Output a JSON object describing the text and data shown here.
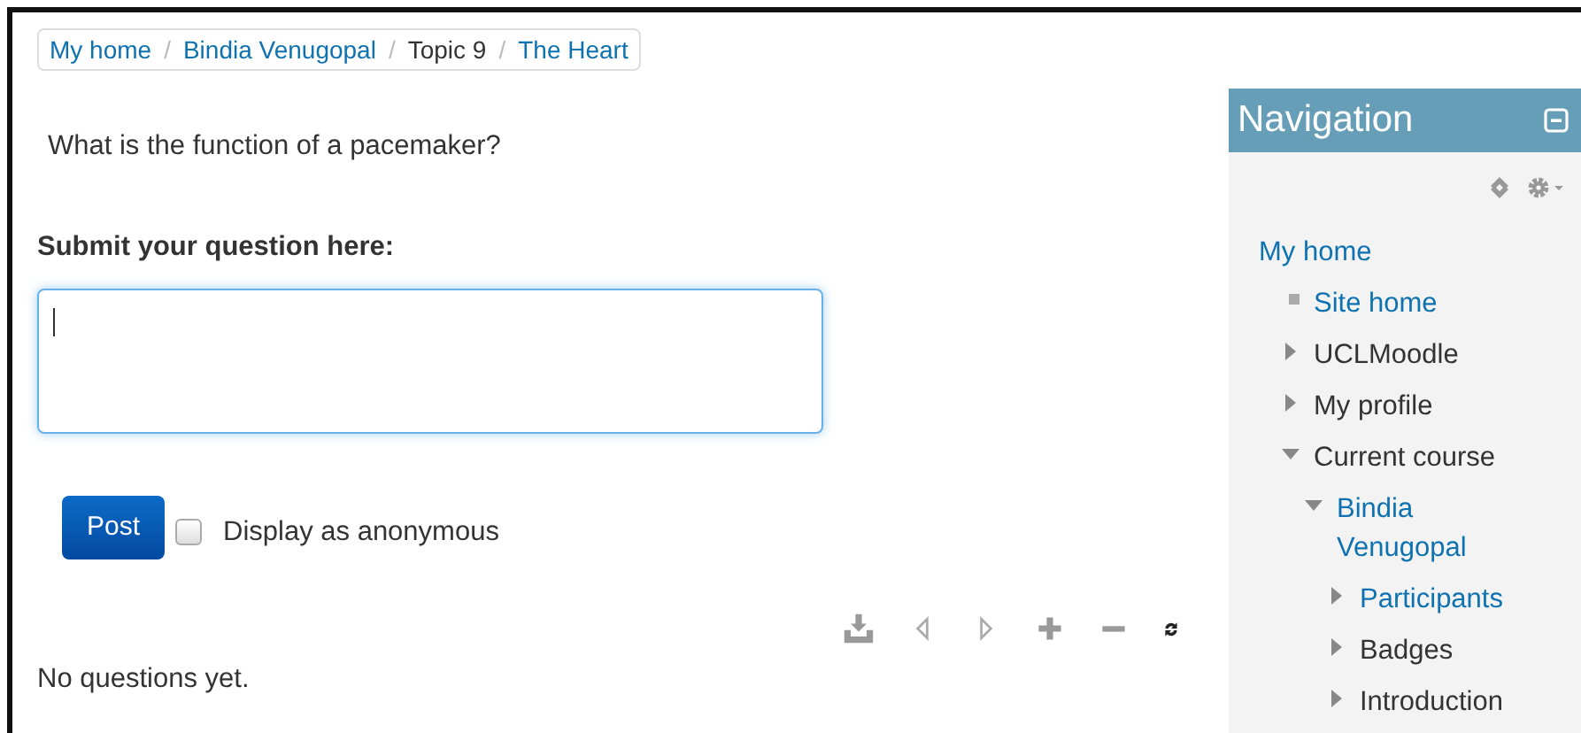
{
  "breadcrumb": [
    {
      "label": "My home",
      "link": true
    },
    {
      "separator": "/",
      "label": "Bindia Venugopal",
      "link": true
    },
    {
      "separator": "/",
      "label": "Topic 9",
      "link": false
    },
    {
      "separator": "/",
      "label": "The Heart",
      "link": true
    }
  ],
  "question": "What is the function of a pacemaker?",
  "form": {
    "label": "Submit your question here:",
    "button": "Post",
    "anonymous": {
      "label": "Display as anonymous",
      "checked": false
    }
  },
  "empty_message": "No questions yet.",
  "navigation": {
    "title": "Navigation",
    "items": [
      {
        "label": "My home",
        "link": true,
        "kind": "root",
        "children": [
          {
            "label": "Site home",
            "link": true,
            "kind": "leaf"
          },
          {
            "label": "UCLMoodle",
            "link": false,
            "kind": "branch",
            "expanded": false
          },
          {
            "label": "My profile",
            "link": false,
            "kind": "branch",
            "expanded": false
          },
          {
            "label": "Current course",
            "link": false,
            "kind": "branch",
            "expanded": true,
            "children": [
              {
                "label": "Bindia Venugopal",
                "link": true,
                "kind": "branch",
                "expanded": true,
                "children": [
                  {
                    "label": "Participants",
                    "link": true,
                    "kind": "branch",
                    "expanded": false
                  },
                  {
                    "label": "Badges",
                    "link": false,
                    "kind": "branch",
                    "expanded": false
                  },
                  {
                    "label": "Introduction",
                    "link": false,
                    "kind": "branch",
                    "expanded": false
                  }
                ]
              }
            ]
          }
        ]
      }
    ]
  }
}
